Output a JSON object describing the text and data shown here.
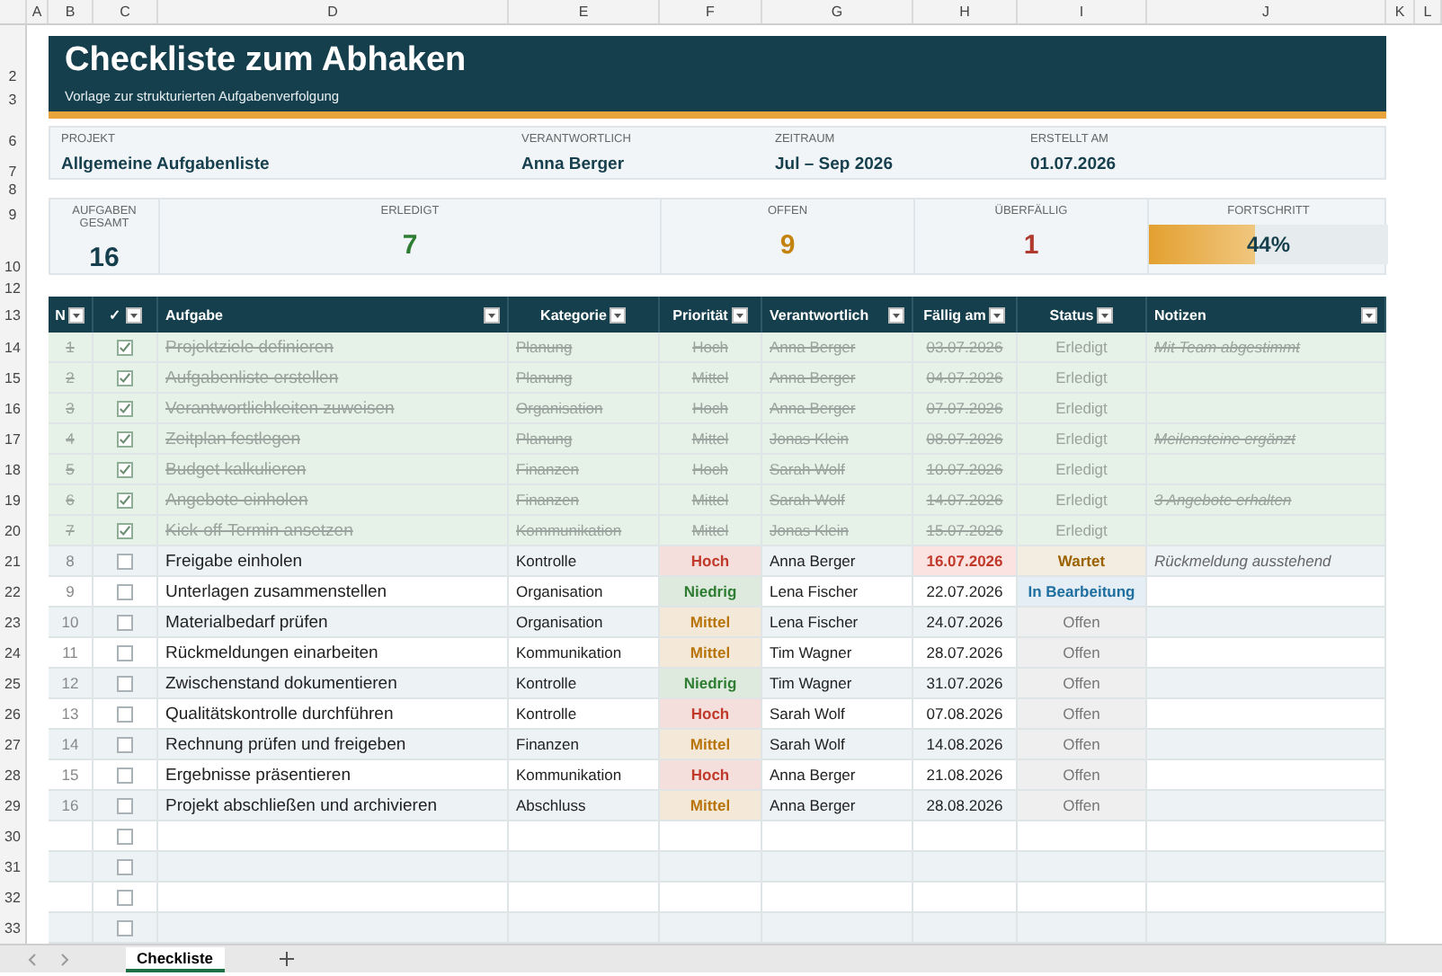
{
  "column_headers": [
    "A",
    "B",
    "C",
    "D",
    "E",
    "F",
    "G",
    "H",
    "I",
    "J",
    "K",
    "L"
  ],
  "header": {
    "row_numbers": [
      "2",
      "3"
    ],
    "title": "Checkliste zum Abhaken",
    "subtitle": "Vorlage zur strukturierten Aufgabenverfolgung"
  },
  "info": {
    "row_numbers": [
      "6",
      "7"
    ],
    "fields": [
      {
        "label": "PROJEKT",
        "value": "Allgemeine Aufgabenliste"
      },
      {
        "label": "VERANTWORTLICH",
        "value": "Anna Berger"
      },
      {
        "label": "ZEITRAUM",
        "value": "Jul – Sep 2026"
      },
      {
        "label": "ERSTELLT AM",
        "value": "01.07.2026"
      }
    ]
  },
  "spacer_row": "8",
  "stats": {
    "row_numbers": [
      "9",
      "10"
    ],
    "items": [
      {
        "kind": "number",
        "label": "AUFGABEN GESAMT",
        "value": "16",
        "color": "#153f4d"
      },
      {
        "kind": "number",
        "label": "ERLEDIGT",
        "value": "7",
        "color": "#2e7d32"
      },
      {
        "kind": "number",
        "label": "OFFEN",
        "value": "9",
        "color": "#c4820f"
      },
      {
        "kind": "number",
        "label": "ÜBERFÄLLIG",
        "value": "1",
        "color": "#b03a2e"
      },
      {
        "kind": "progress",
        "label": "FORTSCHRITT",
        "value": "44%",
        "level": 0.44,
        "color": "#153f4d"
      }
    ]
  },
  "gap_row": "12",
  "table": {
    "header_row": "13",
    "columns": [
      {
        "label": "N"
      },
      {
        "label": "✓"
      },
      {
        "label": "Aufgabe"
      },
      {
        "label": "Kategorie"
      },
      {
        "label": "Priorität"
      },
      {
        "label": "Verantwortlich"
      },
      {
        "label": "Fällig am"
      },
      {
        "label": "Status"
      },
      {
        "label": "Notizen"
      }
    ],
    "rows": [
      {
        "row": "14",
        "number": "1",
        "checked": true,
        "task": "Projektziele definieren",
        "category": "Planung",
        "priority": {
          "text": "Hoch"
        },
        "owner": "Anna Berger",
        "due": {
          "text": "03.07.2026",
          "overdue": false
        },
        "status": {
          "text": "Erledigt"
        },
        "notes": "Mit Team abgestimmt"
      },
      {
        "row": "15",
        "number": "2",
        "checked": true,
        "task": "Aufgabenliste erstellen",
        "category": "Planung",
        "priority": {
          "text": "Mittel"
        },
        "owner": "Anna Berger",
        "due": {
          "text": "04.07.2026",
          "overdue": false
        },
        "status": {
          "text": "Erledigt"
        }
      },
      {
        "row": "16",
        "number": "3",
        "checked": true,
        "task": "Verantwortlichkeiten zuweisen",
        "category": "Organisation",
        "priority": {
          "text": "Hoch"
        },
        "owner": "Anna Berger",
        "due": {
          "text": "07.07.2026",
          "overdue": false
        },
        "status": {
          "text": "Erledigt"
        }
      },
      {
        "row": "17",
        "number": "4",
        "checked": true,
        "task": "Zeitplan festlegen",
        "category": "Planung",
        "priority": {
          "text": "Mittel"
        },
        "owner": "Jonas Klein",
        "due": {
          "text": "08.07.2026",
          "overdue": false
        },
        "status": {
          "text": "Erledigt"
        },
        "notes": "Meilensteine ergänzt"
      },
      {
        "row": "18",
        "number": "5",
        "checked": true,
        "task": "Budget kalkulieren",
        "category": "Finanzen",
        "priority": {
          "text": "Hoch"
        },
        "owner": "Sarah Wolf",
        "due": {
          "text": "10.07.2026",
          "overdue": false
        },
        "status": {
          "text": "Erledigt"
        }
      },
      {
        "row": "19",
        "number": "6",
        "checked": true,
        "task": "Angebote einholen",
        "category": "Finanzen",
        "priority": {
          "text": "Mittel"
        },
        "owner": "Sarah Wolf",
        "due": {
          "text": "14.07.2026",
          "overdue": false
        },
        "status": {
          "text": "Erledigt"
        },
        "notes": "3 Angebote erhalten"
      },
      {
        "row": "20",
        "number": "7",
        "checked": true,
        "task": "Kick-off-Termin ansetzen",
        "category": "Kommunikation",
        "priority": {
          "text": "Mittel"
        },
        "owner": "Jonas Klein",
        "due": {
          "text": "15.07.2026",
          "overdue": false
        },
        "status": {
          "text": "Erledigt"
        }
      },
      {
        "row": "21",
        "number": "8",
        "checked": false,
        "task": "Freigabe einholen",
        "category": "Kontrolle",
        "priority": {
          "text": "Hoch",
          "color": "#c0392b"
        },
        "owner": "Anna Berger",
        "due": {
          "text": "16.07.2026",
          "overdue": true
        },
        "status": {
          "text": "Wartet",
          "color": "#9a6200"
        },
        "notes": "Rückmeldung ausstehend"
      },
      {
        "row": "22",
        "number": "9",
        "checked": false,
        "task": "Unterlagen zusammenstellen",
        "category": "Organisation",
        "priority": {
          "text": "Niedrig",
          "color": "#2e7d32"
        },
        "owner": "Lena Fischer",
        "due": {
          "text": "22.07.2026",
          "overdue": false
        },
        "status": {
          "text": "In Bearbeitung",
          "color": "#1f6fa0"
        }
      },
      {
        "row": "23",
        "number": "10",
        "checked": false,
        "task": "Materialbedarf prüfen",
        "category": "Organisation",
        "priority": {
          "text": "Mittel",
          "color": "#b8740a"
        },
        "owner": "Lena Fischer",
        "due": {
          "text": "24.07.2026",
          "overdue": false
        },
        "status": {
          "text": "Offen",
          "color": "#777777"
        }
      },
      {
        "row": "24",
        "number": "11",
        "checked": false,
        "task": "Rückmeldungen einarbeiten",
        "category": "Kommunikation",
        "priority": {
          "text": "Mittel",
          "color": "#b8740a"
        },
        "owner": "Tim Wagner",
        "due": {
          "text": "28.07.2026",
          "overdue": false
        },
        "status": {
          "text": "Offen",
          "color": "#777777"
        }
      },
      {
        "row": "25",
        "number": "12",
        "checked": false,
        "task": "Zwischenstand dokumentieren",
        "category": "Kontrolle",
        "priority": {
          "text": "Niedrig",
          "color": "#2e7d32"
        },
        "owner": "Tim Wagner",
        "due": {
          "text": "31.07.2026",
          "overdue": false
        },
        "status": {
          "text": "Offen",
          "color": "#777777"
        }
      },
      {
        "row": "26",
        "number": "13",
        "checked": false,
        "task": "Qualitätskontrolle durchführen",
        "category": "Kontrolle",
        "priority": {
          "text": "Hoch",
          "color": "#c0392b"
        },
        "owner": "Sarah Wolf",
        "due": {
          "text": "07.08.2026",
          "overdue": false
        },
        "status": {
          "text": "Offen",
          "color": "#777777"
        }
      },
      {
        "row": "27",
        "number": "14",
        "checked": false,
        "task": "Rechnung prüfen und freigeben",
        "category": "Finanzen",
        "priority": {
          "text": "Mittel",
          "color": "#b8740a"
        },
        "owner": "Sarah Wolf",
        "due": {
          "text": "14.08.2026",
          "overdue": false
        },
        "status": {
          "text": "Offen",
          "color": "#777777"
        }
      },
      {
        "row": "28",
        "number": "15",
        "checked": false,
        "task": "Ergebnisse präsentieren",
        "category": "Kommunikation",
        "priority": {
          "text": "Hoch",
          "color": "#c0392b"
        },
        "owner": "Anna Berger",
        "due": {
          "text": "21.08.2026",
          "overdue": false
        },
        "status": {
          "text": "Offen",
          "color": "#777777"
        }
      },
      {
        "row": "29",
        "number": "16",
        "checked": false,
        "task": "Projekt abschließen und archivieren",
        "category": "Abschluss",
        "priority": {
          "text": "Mittel",
          "color": "#b8740a"
        },
        "owner": "Anna Berger",
        "due": {
          "text": "28.08.2026",
          "overdue": false
        },
        "status": {
          "text": "Offen",
          "color": "#777777"
        }
      },
      {
        "row": "30",
        "checked": false
      },
      {
        "row": "31",
        "checked": false
      },
      {
        "row": "32",
        "checked": false
      },
      {
        "row": "33",
        "checked": false
      }
    ]
  },
  "sheet_tabs": [
    {
      "label": "Checkliste",
      "selected": true
    }
  ]
}
